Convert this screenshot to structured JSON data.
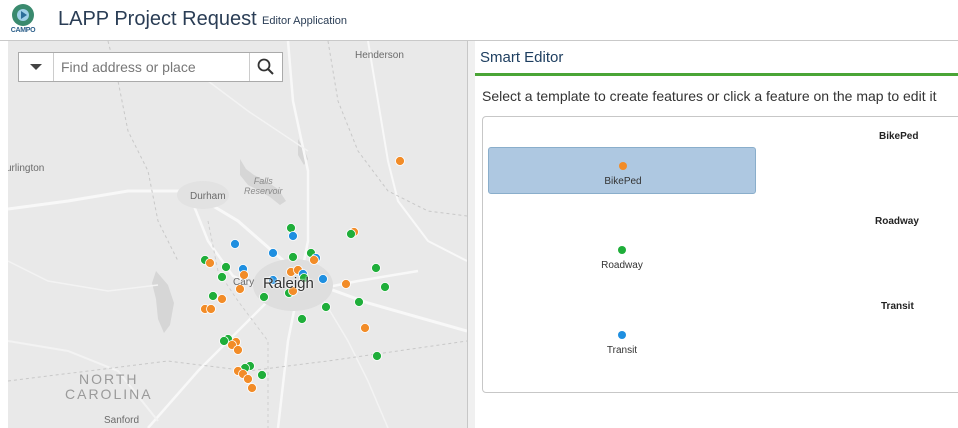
{
  "header": {
    "logo_text": "CAMPO",
    "title": "LAPP Project Request",
    "subtitle": "Editor Application"
  },
  "map": {
    "search": {
      "placeholder": "Find address or place",
      "dropdown_icon": "caret-down-icon",
      "button_icon": "search-icon"
    },
    "labels": {
      "henderson": "Henderson",
      "burlington": "urlington",
      "durham": "Durham",
      "falls": "Falls\nReservoir",
      "cary": "Cary",
      "raleigh": "Raleigh",
      "north_carolina": "NORTH\nCAROLINA",
      "sanford": "Sanford"
    },
    "colors": {
      "bikeped": "#f28c28",
      "roadway": "#1fae3a",
      "transit": "#1f8fe0",
      "background": "#e9e9e9"
    }
  },
  "editor": {
    "title": "Smart Editor",
    "message": "Select a template to create features or click a feature on the map to edit it",
    "groups": [
      {
        "heading": "BikePed",
        "template": "BikePed",
        "color": "#f28c28",
        "selected": true
      },
      {
        "heading": "Roadway",
        "template": "Roadway",
        "color": "#1fae3a",
        "selected": false
      },
      {
        "heading": "Transit",
        "template": "Transit",
        "color": "#1f8fe0",
        "selected": false
      }
    ]
  }
}
